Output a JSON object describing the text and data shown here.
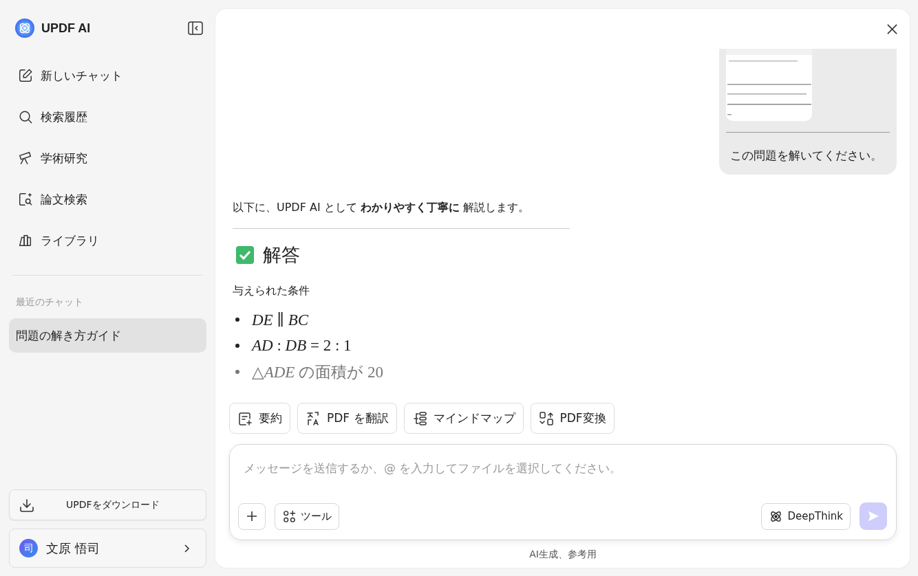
{
  "sidebar": {
    "brand": "UPDF AI",
    "nav": [
      {
        "label": "新しいチャット",
        "kind": "edit"
      },
      {
        "label": "検索履歴",
        "kind": "search"
      },
      {
        "label": "学術研究",
        "kind": "telescope"
      },
      {
        "label": "論文検索",
        "kind": "paper"
      },
      {
        "label": "ライブラリ",
        "kind": "library"
      }
    ],
    "recent_heading": "最近のチャット",
    "recent": [
      {
        "label": "問題の解き方ガイド",
        "selected": true
      }
    ],
    "download": "UPDFをダウンロード",
    "user": {
      "avatar": "司",
      "name": "文原 悟司"
    }
  },
  "chat": {
    "user_message": {
      "text": "この問題を解いてください。"
    },
    "answer": {
      "intro": "以下に、UPDF AI として **わかりやすく丁寧に** 解説します。",
      "heading": "解答",
      "subheading": "与えられた条件",
      "bullets": [
        {
          "text": "*DE* ∥ *BC*",
          "faded": false
        },
        {
          "text": "*AD* : *DB* = 2 : 1",
          "faded": false
        },
        {
          "text": "△*ADE* の面積が 20",
          "faded": true
        }
      ]
    }
  },
  "chips": [
    {
      "label": "要約",
      "kind": "summary"
    },
    {
      "label": "PDF を翻訳",
      "kind": "translate"
    },
    {
      "label": "マインドマップ",
      "kind": "mindmap"
    },
    {
      "label": "PDF変換",
      "kind": "convert"
    }
  ],
  "composer": {
    "placeholder": "メッセージを送信するか、@ を入力してファイルを選択してください。",
    "tools": "ツール",
    "deepthink": {
      "label": "DeepThink",
      "on": false
    },
    "send_enabled": false
  },
  "footer": "AI生成、参考用"
}
